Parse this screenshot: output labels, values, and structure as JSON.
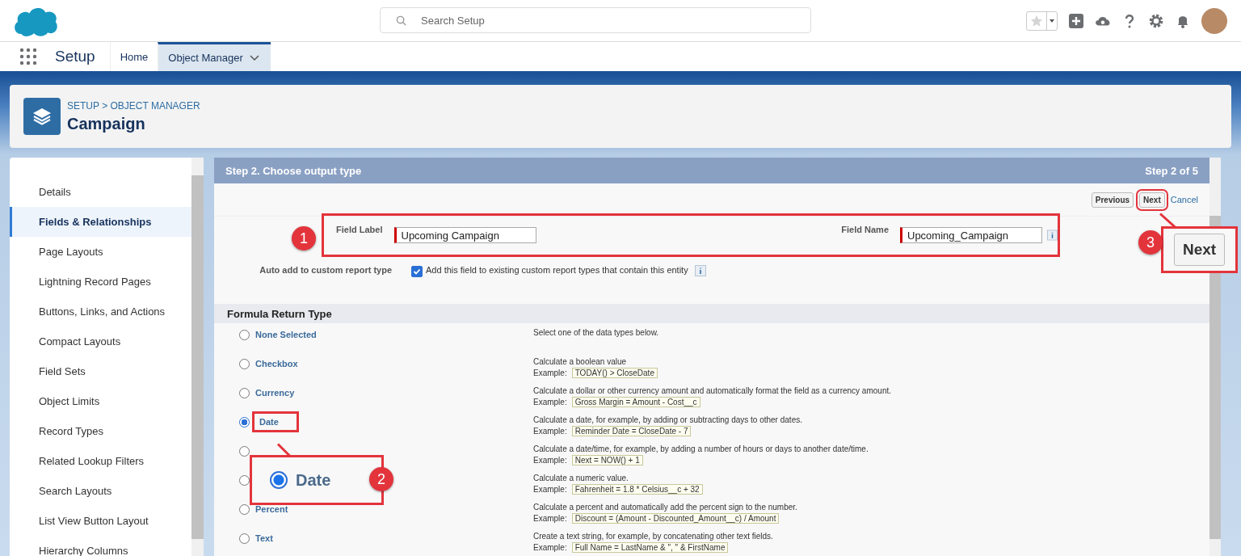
{
  "header": {
    "search": {
      "placeholder": "Search Setup"
    }
  },
  "nav": {
    "app_name": "Setup",
    "tabs": [
      {
        "label": "Home",
        "selected": false
      },
      {
        "label": "Object Manager",
        "selected": true
      }
    ]
  },
  "page_header": {
    "breadcrumb": "SETUP > OBJECT MANAGER",
    "title": "Campaign"
  },
  "sidebar": {
    "items": [
      {
        "label": "Details",
        "selected": false
      },
      {
        "label": "Fields & Relationships",
        "selected": true
      },
      {
        "label": "Page Layouts",
        "selected": false
      },
      {
        "label": "Lightning Record Pages",
        "selected": false
      },
      {
        "label": "Buttons, Links, and Actions",
        "selected": false
      },
      {
        "label": "Compact Layouts",
        "selected": false
      },
      {
        "label": "Field Sets",
        "selected": false
      },
      {
        "label": "Object Limits",
        "selected": false
      },
      {
        "label": "Record Types",
        "selected": false
      },
      {
        "label": "Related Lookup Filters",
        "selected": false
      },
      {
        "label": "Search Layouts",
        "selected": false
      },
      {
        "label": "List View Button Layout",
        "selected": false
      },
      {
        "label": "Hierarchy Columns",
        "selected": false
      }
    ]
  },
  "wizard": {
    "step_title": "Step 2. Choose output type",
    "step_counter": "Step 2 of 5",
    "buttons": {
      "previous": "Previous",
      "next": "Next",
      "cancel": "Cancel"
    },
    "field_label": {
      "label": "Field Label",
      "value": "Upcoming Campaign"
    },
    "field_name": {
      "label": "Field Name",
      "value": "Upcoming_Campaign"
    },
    "auto_add": {
      "label": "Auto add to custom report type",
      "checked": true,
      "text": "Add this field to existing custom report types that contain this entity"
    },
    "section_title": "Formula Return Type",
    "return_types": [
      {
        "label": "None Selected",
        "selected": false,
        "description": "Select one of the data types below."
      },
      {
        "label": "Checkbox",
        "selected": false,
        "description": "Calculate a boolean value",
        "example_prefix": "Example:",
        "example": "TODAY() > CloseDate"
      },
      {
        "label": "Currency",
        "selected": false,
        "description": "Calculate a dollar or other currency amount and automatically format the field as a currency amount.",
        "example_prefix": "Example:",
        "example": "Gross Margin = Amount - Cost__c"
      },
      {
        "label": "Date",
        "selected": true,
        "description": "Calculate a date, for example, by adding or subtracting days to other dates.",
        "example_prefix": "Example:",
        "example": "Reminder Date = CloseDate - 7"
      },
      {
        "selected": false,
        "description": "Calculate a date/time, for example, by adding a number of hours or days to another date/time.",
        "example_prefix": "Example:",
        "example": "Next = NOW() + 1"
      },
      {
        "selected": false,
        "description": "Calculate a numeric value.",
        "example_prefix": "Example:",
        "example": "Fahrenheit = 1.8 * Celsius__c + 32"
      },
      {
        "label": "Percent",
        "selected": false,
        "description": "Calculate a percent and automatically add the percent sign to the number.",
        "example_prefix": "Example:",
        "example": "Discount = (Amount - Discounted_Amount__c) / Amount"
      },
      {
        "label": "Text",
        "selected": false,
        "description": "Create a text string, for example, by concatenating other text fields.",
        "example_prefix": "Example:",
        "example": "Full Name = LastName & \", \" & FirstName"
      }
    ]
  },
  "callouts": [
    {
      "number": "1"
    },
    {
      "number": "2",
      "text": "Date",
      "selected": true
    },
    {
      "number": "3",
      "text": "Next"
    }
  ]
}
